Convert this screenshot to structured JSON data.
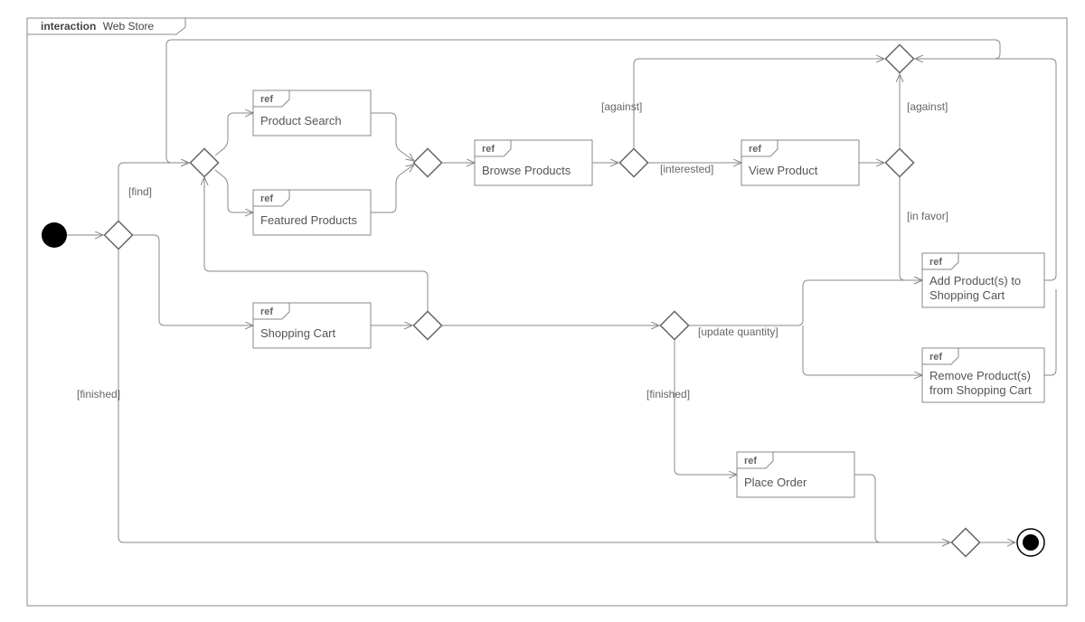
{
  "frame": {
    "keyword": "interaction",
    "name": "Web Store"
  },
  "refs": {
    "productSearch": {
      "ref": "ref",
      "label": "Product Search"
    },
    "featuredProducts": {
      "ref": "ref",
      "label": "Featured Products"
    },
    "browseProducts": {
      "ref": "ref",
      "label": "Browse Products"
    },
    "viewProduct": {
      "ref": "ref",
      "label": "View Product"
    },
    "shoppingCart": {
      "ref": "ref",
      "label": "Shopping Cart"
    },
    "addProducts": {
      "ref": "ref",
      "line1": "Add Product(s) to",
      "line2": "Shopping Cart"
    },
    "removeProducts": {
      "ref": "ref",
      "line1": "Remove Product(s)",
      "line2": "from Shopping Cart"
    },
    "placeOrder": {
      "ref": "ref",
      "label": "Place Order"
    }
  },
  "guards": {
    "find": "[find]",
    "finishedLeft": "[finished]",
    "against1": "[against]",
    "interested": "[interested]",
    "against2": "[against]",
    "inFavor": "[in favor]",
    "updateQty": "[update quantity]",
    "finishedMid": "[finished]"
  }
}
